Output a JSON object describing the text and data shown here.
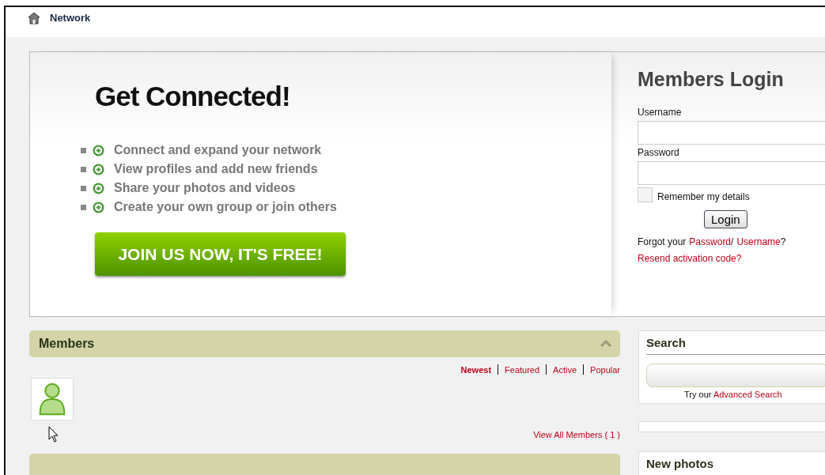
{
  "header": {
    "title": "Network"
  },
  "hero": {
    "title": "Get Connected!",
    "features": [
      "Connect and expand your network",
      "View profiles and add new friends",
      "Share your photos and videos",
      "Create your own group or join others"
    ],
    "join_button": "JOIN US NOW, IT'S FREE!"
  },
  "login": {
    "title": "Members Login",
    "username_label": "Username",
    "password_label": "Password",
    "remember": {
      "label": "Remember my details",
      "checked": false
    },
    "button": "Login",
    "forgot_prefix": "Forgot your",
    "forgot_password": "Password",
    "forgot_sep": "/",
    "forgot_username": "Username",
    "forgot_suffix": "?",
    "resend": "Resend activation code?"
  },
  "members": {
    "title": "Members",
    "tabs": [
      {
        "label": "Newest",
        "selected": true
      },
      {
        "label": "Featured",
        "selected": false
      },
      {
        "label": "Active",
        "selected": false
      },
      {
        "label": "Popular",
        "selected": false
      }
    ],
    "view_all": "View All Members ( 1 )"
  },
  "search": {
    "title": "Search",
    "hint_prefix": "Try our",
    "hint_link": "Advanced Search"
  },
  "new_photos": {
    "title": "New photos"
  }
}
